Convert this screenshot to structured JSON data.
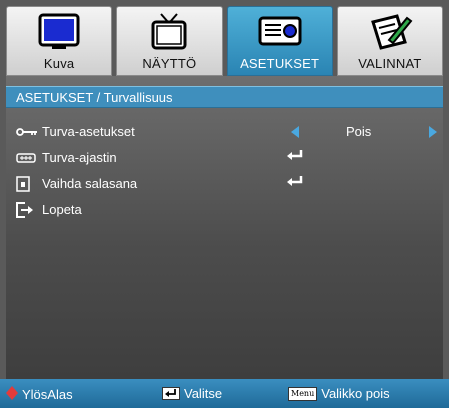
{
  "tabs": [
    {
      "label": "Kuva",
      "icon": "monitor-icon",
      "active": false
    },
    {
      "label": "NÄYTTÖ",
      "icon": "tv-icon",
      "active": false
    },
    {
      "label": "ASETUKSET",
      "icon": "projector-icon",
      "active": true
    },
    {
      "label": "VALINNAT",
      "icon": "pen-paper-icon",
      "active": false
    }
  ],
  "section_title": "ASETUKSET / Turvallisuus",
  "rows": [
    {
      "label": "Turva-asetukset",
      "icon": "key-icon",
      "value": "Pois"
    },
    {
      "label": "Turva-ajastin",
      "icon": "timer-icon"
    },
    {
      "label": "Vaihda salasana",
      "icon": "password-icon"
    },
    {
      "label": "Lopeta",
      "icon": "exit-icon"
    }
  ],
  "footer": {
    "nav_label": "YlösAlas",
    "select_label": "Valitse",
    "menu_key": "Menu",
    "exit_label": "Valikko pois"
  },
  "colors": {
    "accent": "#3f8fbd",
    "active_tab": "#2a84b3",
    "arrow": "#4aa8e0",
    "nav_diamond": "#e23b3b"
  }
}
